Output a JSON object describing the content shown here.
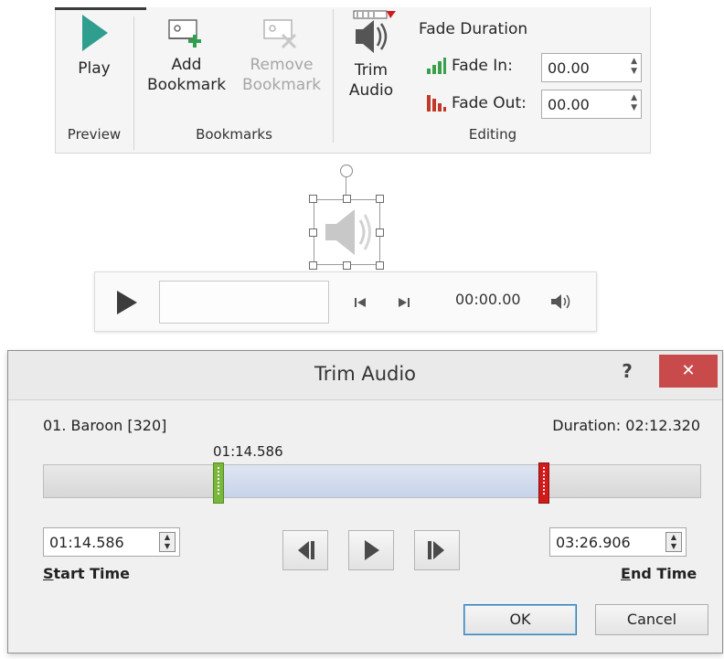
{
  "ribbon": {
    "preview": {
      "group_label": "Preview",
      "play_label": "Play"
    },
    "bookmarks": {
      "group_label": "Bookmarks",
      "add_line1": "Add",
      "add_line2": "Bookmark",
      "remove_line1": "Remove",
      "remove_line2": "Bookmark"
    },
    "editing": {
      "group_label": "Editing",
      "trim_line1": "Trim",
      "trim_line2": "Audio",
      "fade_title": "Fade Duration",
      "fade_in_label": "Fade In:",
      "fade_in_value": "00.00",
      "fade_out_label": "Fade Out:",
      "fade_out_value": "00.00"
    }
  },
  "player": {
    "time": "00:00.00"
  },
  "dialog": {
    "title": "Trim Audio",
    "help": "?",
    "close": "✕",
    "file_name": "01. Baroon [320]",
    "duration": "Duration: 02:12.320",
    "marker_time": "01:14.586",
    "start_time_value": "01:14.586",
    "start_time_label_first": "S",
    "start_time_label_rest": "tart Time",
    "end_time_value": "03:26.906",
    "end_time_label_first": "E",
    "end_time_label_rest": "nd Time",
    "ok": "OK",
    "cancel": "Cancel"
  },
  "colors": {
    "play_green": "#2f9e8f",
    "start_marker": "#7ab83d",
    "end_marker": "#d11b1b",
    "close_red": "#c94a4a",
    "selection_blue": "#c7d3ea"
  },
  "icons": {
    "play": "play-triangle-icon",
    "add_bookmark": "add-bookmark-icon",
    "remove_bookmark": "remove-bookmark-icon",
    "trim_audio": "trim-audio-icon",
    "fade_in": "fade-in-bars-icon",
    "fade_out": "fade-out-bars-icon",
    "speaker": "speaker-icon"
  }
}
